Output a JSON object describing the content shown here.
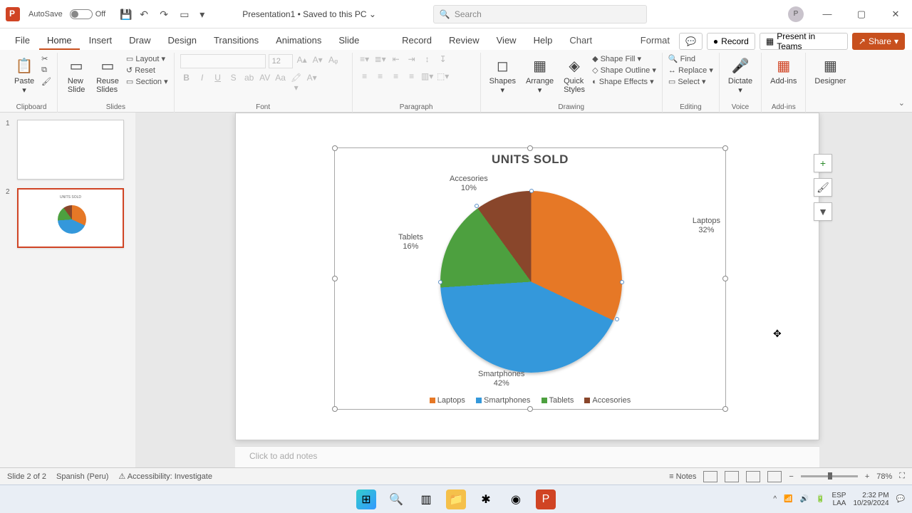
{
  "titlebar": {
    "autosave_label": "AutoSave",
    "autosave_state": "Off",
    "doc_title": "Presentation1 • Saved to this PC ⌄",
    "search_placeholder": "Search"
  },
  "window_controls": {
    "user_initial": "P"
  },
  "tabs": {
    "items": [
      "File",
      "Home",
      "Insert",
      "Draw",
      "Design",
      "Transitions",
      "Animations",
      "Slide Show",
      "Record",
      "Review",
      "View",
      "Help",
      "Chart Design",
      "Format"
    ],
    "active": "Home",
    "record_btn": "Record",
    "present_btn": "Present in Teams",
    "share_btn": "Share"
  },
  "ribbon": {
    "clipboard": {
      "paste": "Paste",
      "group": "Clipboard"
    },
    "slides": {
      "new_slide": "New\nSlide",
      "reuse": "Reuse\nSlides",
      "layout": "Layout ▾",
      "reset": "Reset",
      "section": "Section ▾",
      "group": "Slides"
    },
    "font": {
      "size": "12",
      "group": "Font"
    },
    "paragraph": {
      "group": "Paragraph"
    },
    "drawing": {
      "shapes": "Shapes",
      "arrange": "Arrange",
      "quick": "Quick\nStyles",
      "fill": "Shape Fill ▾",
      "outline": "Shape Outline ▾",
      "effects": "Shape Effects ▾",
      "group": "Drawing"
    },
    "editing": {
      "find": "Find",
      "replace": "Replace ▾",
      "select": "Select ▾",
      "group": "Editing"
    },
    "voice": {
      "dictate": "Dictate",
      "group": "Voice"
    },
    "addins": {
      "addins": "Add-ins",
      "group": "Add-ins"
    },
    "designer": {
      "designer": "Designer"
    }
  },
  "thumbs": {
    "s1_num": "1",
    "s2_num": "2"
  },
  "chart_data": {
    "type": "pie",
    "title": "UNITS SOLD",
    "series": [
      {
        "name": "Laptops",
        "value": 32,
        "color": "#e67826"
      },
      {
        "name": "Smartphones",
        "value": 42,
        "color": "#3498db"
      },
      {
        "name": "Tablets",
        "value": 16,
        "color": "#4da03f"
      },
      {
        "name": "Accesories",
        "value": 10,
        "color": "#89462b"
      }
    ],
    "labels": {
      "laptops_name": "Laptops",
      "laptops_pct": "32%",
      "smartphones_name": "Smartphones",
      "smartphones_pct": "42%",
      "tablets_name": "Tablets",
      "tablets_pct": "16%",
      "accesories_name": "Accesories",
      "accesories_pct": "10%"
    },
    "legend": {
      "l0": "Laptops",
      "l1": "Smartphones",
      "l2": "Tablets",
      "l3": "Accesories"
    }
  },
  "notes": {
    "placeholder": "Click to add notes"
  },
  "statusbar": {
    "slide_info": "Slide 2 of 2",
    "language": "Spanish (Peru)",
    "accessibility": "Accessibility: Investigate",
    "notes_btn": "Notes",
    "zoom_pct": "78%"
  },
  "tray": {
    "kbd": "ESP",
    "loc": "LAA",
    "time": "2:32 PM",
    "date": "10/29/2024"
  }
}
